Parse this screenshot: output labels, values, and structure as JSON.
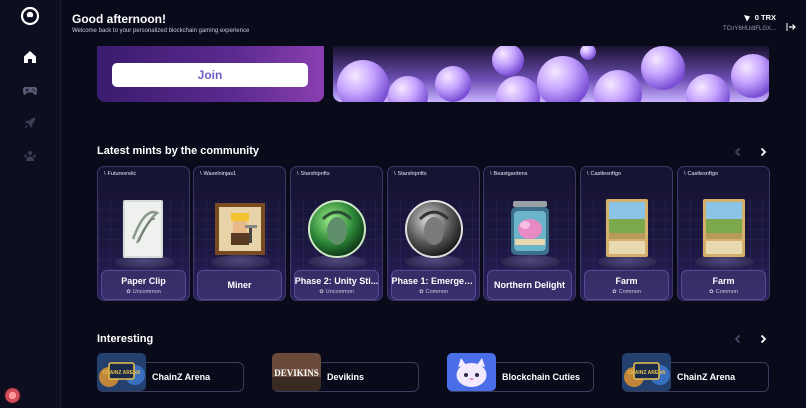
{
  "header": {
    "greeting": "Good afternoon!",
    "subtitle": "Welcome back to your personalized blockchain gaming experience"
  },
  "wallet": {
    "balance": "0 TRX",
    "address": "TCnY8HUdtFLGX..."
  },
  "banner": {
    "join_label": "Join"
  },
  "sections": {
    "mints_title": "Latest mints by the community",
    "interesting_title": "Interesting"
  },
  "mints": [
    {
      "creator": "Futurexrelic",
      "name": "Paper Clip",
      "rarity": "Uncommon"
    },
    {
      "creator": "Waxelninjas1",
      "name": "Miner",
      "rarity": ""
    },
    {
      "creator": "Starshipnfts",
      "name": "Phase 2: Unity Sti...",
      "rarity": "Uncommon"
    },
    {
      "creator": "Starshipnfts",
      "name": "Phase 1: Emergen...",
      "rarity": "Common"
    },
    {
      "creator": "Beastgardens",
      "name": "Northern Delight",
      "rarity": ""
    },
    {
      "creator": "Castlesnftgo",
      "name": "Farm",
      "rarity": "Common"
    },
    {
      "creator": "Castlesnftgo",
      "name": "Farm",
      "rarity": "Common"
    }
  ],
  "games": [
    {
      "name": "ChainZ Arena",
      "thumb_text": "CHAINZ ARENA"
    },
    {
      "name": "Devikins",
      "thumb_text": "DEVIKINS"
    },
    {
      "name": "Blockchain Cuties",
      "thumb_text": ""
    },
    {
      "name": "ChainZ Arena",
      "thumb_text": "CHAINZ ARENA"
    }
  ],
  "colors": {
    "background": "#0a0b1a",
    "accent": "#6c5fc7",
    "card_border": "#3e3766"
  }
}
